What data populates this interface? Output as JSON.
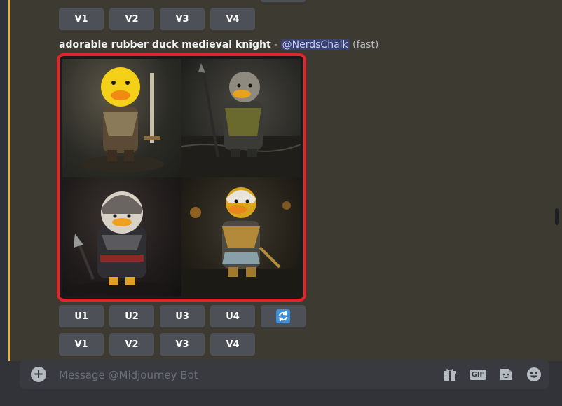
{
  "top_variation_row": [
    "V1",
    "V2",
    "V3",
    "V4"
  ],
  "message": {
    "prompt": "adorable rubber duck medieval knight",
    "separator": " - ",
    "mention": "@NerdsChalk",
    "speed": "(fast)"
  },
  "image_grid": {
    "tiles": [
      "duck-knight-with-sword",
      "duck-knight-with-spear",
      "duck-knight-helmet",
      "duck-knight-golden-armor"
    ]
  },
  "upscale_row": [
    "U1",
    "U2",
    "U3",
    "U4"
  ],
  "reroll_icon": "refresh-icon",
  "variation_row": [
    "V1",
    "V2",
    "V3",
    "V4"
  ],
  "composer": {
    "placeholder": "Message @Midjourney Bot",
    "icons": [
      "gift-icon",
      "gif-icon",
      "sticker-icon",
      "emoji-icon"
    ],
    "gif_label": "GIF"
  },
  "colors": {
    "highlight": "#f0b232",
    "selection_border": "#e3242b",
    "button_bg": "#4e5058",
    "mention_bg": "#3c4270"
  }
}
